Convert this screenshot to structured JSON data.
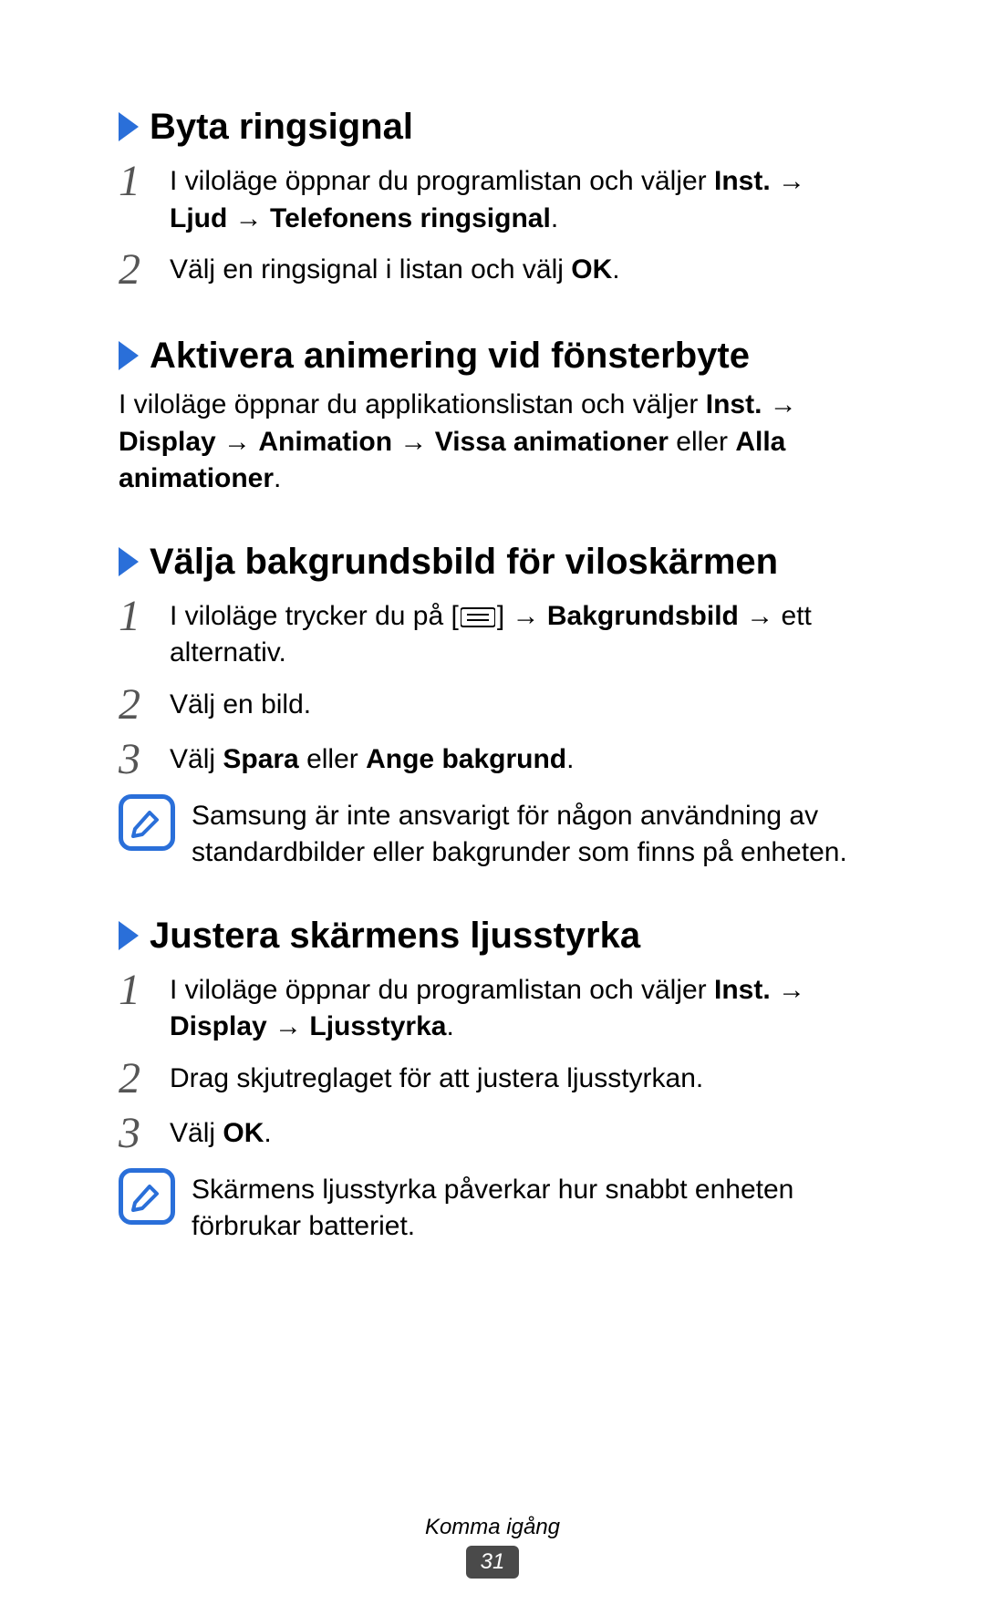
{
  "sections": [
    {
      "heading": "Byta ringsignal",
      "steps": [
        {
          "num": "1",
          "parts": [
            {
              "t": "I viloläge öppnar du programlistan och väljer "
            },
            {
              "t": "Inst.",
              "b": true
            },
            {
              "t": " → "
            },
            {
              "t": "Ljud",
              "b": true
            },
            {
              "t": " → "
            },
            {
              "t": "Telefonens ringsignal",
              "b": true
            },
            {
              "t": "."
            }
          ]
        },
        {
          "num": "2",
          "parts": [
            {
              "t": "Välj en ringsignal i listan och välj "
            },
            {
              "t": "OK",
              "b": true
            },
            {
              "t": "."
            }
          ]
        }
      ]
    },
    {
      "heading": "Aktivera animering vid fönsterbyte",
      "paragraph": [
        {
          "t": "I viloläge öppnar du applikationslistan och väljer "
        },
        {
          "t": "Inst.",
          "b": true
        },
        {
          "t": " → "
        },
        {
          "t": "Display",
          "b": true
        },
        {
          "t": " → "
        },
        {
          "t": "Animation",
          "b": true
        },
        {
          "t": " → "
        },
        {
          "t": "Vissa animationer",
          "b": true
        },
        {
          "t": " eller "
        },
        {
          "t": "Alla animationer",
          "b": true
        },
        {
          "t": "."
        }
      ]
    },
    {
      "heading": "Välja bakgrundsbild för viloskärmen",
      "steps": [
        {
          "num": "1",
          "parts": [
            {
              "t": "I viloläge trycker du på ["
            },
            {
              "icon": "menu"
            },
            {
              "t": "] → "
            },
            {
              "t": "Bakgrundsbild",
              "b": true
            },
            {
              "t": " → ett alternativ."
            }
          ]
        },
        {
          "num": "2",
          "parts": [
            {
              "t": "Välj en bild."
            }
          ]
        },
        {
          "num": "3",
          "parts": [
            {
              "t": "Välj "
            },
            {
              "t": "Spara",
              "b": true
            },
            {
              "t": " eller "
            },
            {
              "t": "Ange bakgrund",
              "b": true
            },
            {
              "t": "."
            }
          ]
        }
      ],
      "note": "Samsung är inte ansvarigt för någon användning av standardbilder eller bakgrunder som finns på enheten."
    },
    {
      "heading": "Justera skärmens ljusstyrka",
      "steps": [
        {
          "num": "1",
          "parts": [
            {
              "t": "I viloläge öppnar du programlistan och väljer "
            },
            {
              "t": "Inst.",
              "b": true
            },
            {
              "t": " → "
            },
            {
              "t": "Display",
              "b": true
            },
            {
              "t": " → "
            },
            {
              "t": "Ljusstyrka",
              "b": true
            },
            {
              "t": "."
            }
          ]
        },
        {
          "num": "2",
          "parts": [
            {
              "t": "Drag skjutreglaget för att justera ljusstyrkan."
            }
          ]
        },
        {
          "num": "3",
          "parts": [
            {
              "t": "Välj "
            },
            {
              "t": "OK",
              "b": true
            },
            {
              "t": "."
            }
          ]
        }
      ],
      "note": "Skärmens ljusstyrka påverkar hur snabbt enheten förbrukar batteriet."
    }
  ],
  "footer": {
    "label": "Komma igång",
    "page": "31"
  }
}
